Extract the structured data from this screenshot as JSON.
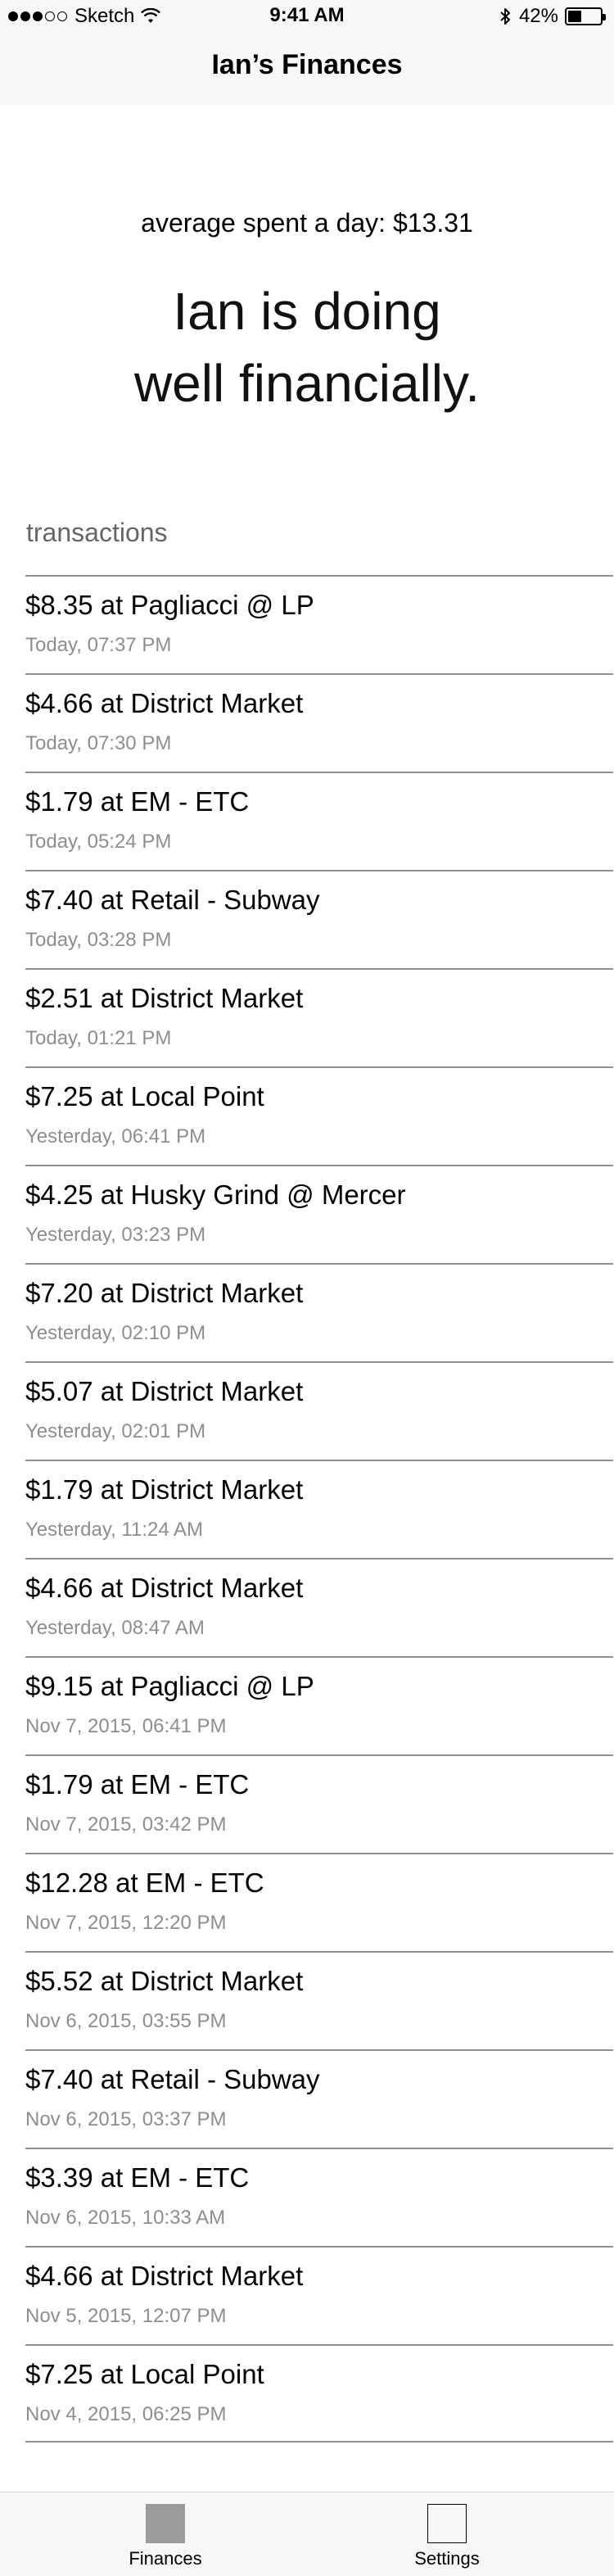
{
  "status_bar": {
    "carrier": "Sketch",
    "time": "9:41 AM",
    "battery_percent": "42%",
    "battery_level": 0.42
  },
  "nav": {
    "title": "Ian’s Finances"
  },
  "summary": {
    "average": "average spent a day: $13.31",
    "status": "Ian is doing well financially."
  },
  "transactions": {
    "header": "transactions",
    "items": [
      {
        "title": "$8.35 at Pagliacci @ LP",
        "time": "Today, 07:37 PM"
      },
      {
        "title": "$4.66 at District Market",
        "time": "Today, 07:30 PM"
      },
      {
        "title": "$1.79 at EM - ETC",
        "time": "Today, 05:24 PM"
      },
      {
        "title": "$7.40 at Retail - Subway",
        "time": "Today, 03:28 PM"
      },
      {
        "title": "$2.51 at District Market",
        "time": "Today, 01:21 PM"
      },
      {
        "title": "$7.25 at Local Point",
        "time": "Yesterday, 06:41 PM"
      },
      {
        "title": "$4.25 at Husky Grind @ Mercer",
        "time": "Yesterday, 03:23 PM"
      },
      {
        "title": "$7.20 at District Market",
        "time": "Yesterday, 02:10 PM"
      },
      {
        "title": "$5.07 at District Market",
        "time": "Yesterday, 02:01 PM"
      },
      {
        "title": "$1.79 at District Market",
        "time": "Yesterday, 11:24 AM"
      },
      {
        "title": "$4.66 at District Market",
        "time": "Yesterday, 08:47 AM"
      },
      {
        "title": "$9.15 at Pagliacci @ LP",
        "time": "Nov 7, 2015, 06:41 PM"
      },
      {
        "title": "$1.79 at EM - ETC",
        "time": "Nov 7, 2015, 03:42 PM"
      },
      {
        "title": "$12.28 at EM - ETC",
        "time": "Nov 7, 2015, 12:20 PM"
      },
      {
        "title": "$5.52 at District Market",
        "time": "Nov 6, 2015, 03:55 PM"
      },
      {
        "title": "$7.40 at Retail - Subway",
        "time": "Nov 6, 2015, 03:37 PM"
      },
      {
        "title": "$3.39 at EM - ETC",
        "time": "Nov 6, 2015, 10:33 AM"
      },
      {
        "title": "$4.66 at District Market",
        "time": "Nov 5, 2015, 12:07 PM"
      },
      {
        "title": "$7.25 at Local Point",
        "time": "Nov 4, 2015, 06:25 PM"
      }
    ]
  },
  "tab_bar": {
    "tabs": [
      {
        "label": "Finances",
        "icon": "finances-tab-icon"
      },
      {
        "label": "Settings",
        "icon": "settings-tab-icon"
      }
    ]
  },
  "colors": {
    "bar_background": "#f7f7f7",
    "separator": "#909090",
    "secondary_text": "#8e8e8e",
    "section_header": "#666666",
    "finances_icon_fill": "#9b9b9b"
  }
}
